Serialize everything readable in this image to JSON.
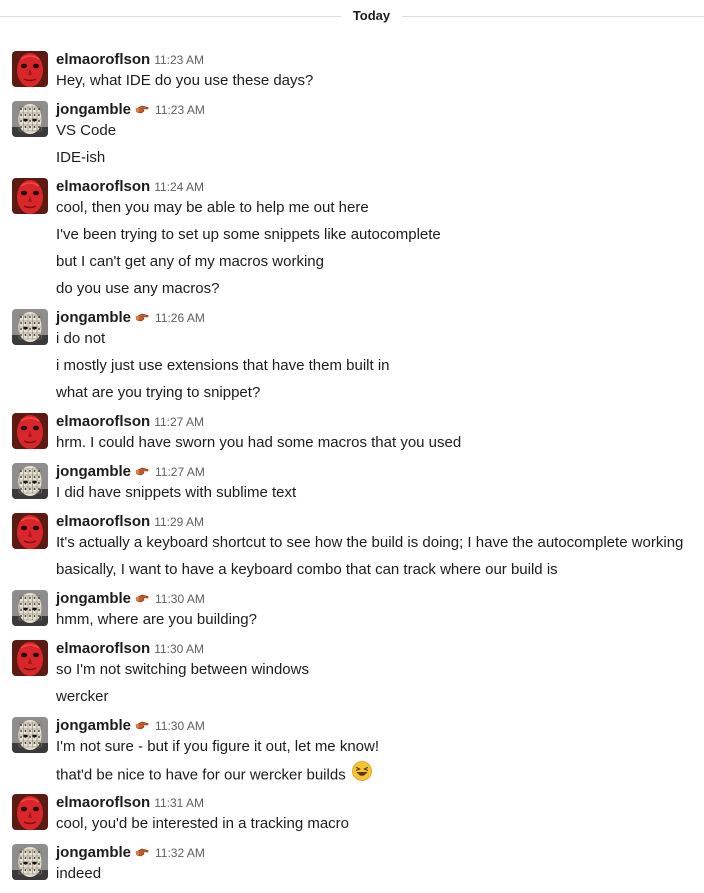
{
  "divider": {
    "label": "Today"
  },
  "users": {
    "elmaoroflson": {
      "name": "elmaoroflson",
      "avatar_icon": "red-mask-avatar-icon",
      "accent": "#cc2222"
    },
    "jongamble": {
      "name": "jongamble",
      "avatar_icon": "pinhead-avatar-icon",
      "badge_icon": "pointing-hand-icon"
    }
  },
  "messages": [
    {
      "user": "elmaoroflson",
      "time": "11:23 AM",
      "lines": [
        "Hey, what IDE do you use these days?"
      ]
    },
    {
      "user": "jongamble",
      "time": "11:23 AM",
      "lines": [
        "VS Code",
        "IDE-ish"
      ]
    },
    {
      "user": "elmaoroflson",
      "time": "11:24 AM",
      "lines": [
        "cool, then you may be able to help me out here",
        "I've been trying to set up some snippets like autocomplete",
        "but I can't get any of my macros working",
        "do you use any macros?"
      ]
    },
    {
      "user": "jongamble",
      "time": "11:26 AM",
      "lines": [
        "i do not",
        "i mostly just use extensions that have them built in",
        "what are you trying to snippet?"
      ]
    },
    {
      "user": "elmaoroflson",
      "time": "11:27 AM",
      "lines": [
        "hrm. I could have sworn you had some macros that you used"
      ]
    },
    {
      "user": "jongamble",
      "time": "11:27 AM",
      "lines": [
        "I did have snippets with sublime text"
      ]
    },
    {
      "user": "elmaoroflson",
      "time": "11:29 AM",
      "lines": [
        "It's actually a keyboard shortcut to see how the build is doing; I have the autocomplete working",
        "basically, I want to have a keyboard combo that can track where our build is"
      ]
    },
    {
      "user": "jongamble",
      "time": "11:30 AM",
      "lines": [
        "hmm, where are you building?"
      ]
    },
    {
      "user": "elmaoroflson",
      "time": "11:30 AM",
      "lines": [
        "so I'm not switching between windows",
        "wercker"
      ]
    },
    {
      "user": "jongamble",
      "time": "11:30 AM",
      "lines": [
        "I'm not sure - but if you figure it out, let me know!",
        "that'd be nice to have for our wercker builds"
      ],
      "emoji_icon": "laughing-face-emoji-icon"
    },
    {
      "user": "elmaoroflson",
      "time": "11:31 AM",
      "lines": [
        "cool, you'd be interested in a tracking macro"
      ]
    },
    {
      "user": "jongamble",
      "time": "11:32 AM",
      "lines": [
        "indeed"
      ]
    }
  ]
}
